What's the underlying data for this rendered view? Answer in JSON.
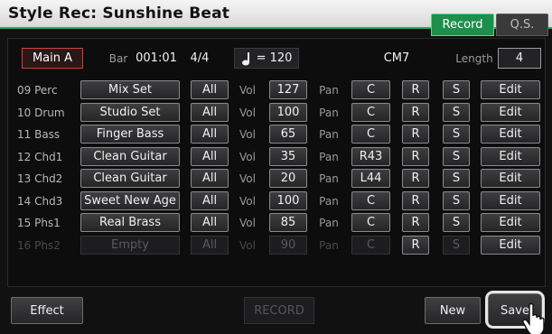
{
  "window": {
    "title": "Style Rec: Sunshine Beat"
  },
  "tabs": {
    "record": "Record",
    "qs": "Q.S."
  },
  "info": {
    "section": "Main A",
    "bar_label": "Bar",
    "bar_value": "001:01",
    "time_sig": "4/4",
    "tempo": "= 120",
    "chord": "CM7",
    "length_label": "Length",
    "length_value": "4"
  },
  "column_labels": {
    "all": "All",
    "vol": "Vol",
    "pan": "Pan",
    "r": "R",
    "s": "S",
    "edit": "Edit"
  },
  "tracks": [
    {
      "id": "09 Perc",
      "voice": "Mix Set",
      "vol": "127",
      "pan": "C",
      "enabled": true
    },
    {
      "id": "10 Drum",
      "voice": "Studio Set",
      "vol": "100",
      "pan": "C",
      "enabled": true
    },
    {
      "id": "11 Bass",
      "voice": "Finger Bass",
      "vol": "65",
      "pan": "C",
      "enabled": true
    },
    {
      "id": "12 Chd1",
      "voice": "Clean Guitar",
      "vol": "35",
      "pan": "R43",
      "enabled": true
    },
    {
      "id": "13 Chd2",
      "voice": "Clean Guitar",
      "vol": "20",
      "pan": "L44",
      "enabled": true
    },
    {
      "id": "14 Chd3",
      "voice": "Sweet New Age",
      "vol": "100",
      "pan": "C",
      "enabled": true
    },
    {
      "id": "15 Phs1",
      "voice": "Real Brass",
      "vol": "85",
      "pan": "C",
      "enabled": true
    },
    {
      "id": "16 Phs2",
      "voice": "Empty",
      "vol": "90",
      "pan": "C",
      "enabled": false
    }
  ],
  "bottom": {
    "effect": "Effect",
    "record": "RECORD",
    "new": "New",
    "save": "Save"
  },
  "colors": {
    "accent_green": "#1e8f4b",
    "section_red": "#d0403a"
  },
  "icons": {
    "tempo": "quarter-note-icon",
    "cursor": "hand-pointer-icon"
  }
}
